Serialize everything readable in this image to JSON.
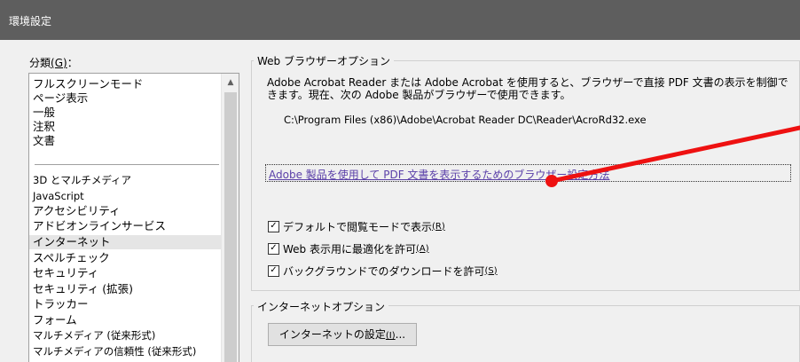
{
  "window": {
    "title": "環境設定"
  },
  "categories": {
    "label": "分類",
    "accel": "(G)",
    "colon": "：",
    "group1": [
      "フルスクリーンモード",
      "ページ表示",
      "一般",
      "注釈",
      "文書"
    ],
    "group2": [
      "3D とマルチメディア",
      "JavaScript",
      "アクセシビリティ",
      "アドビオンラインサービス",
      "インターネット",
      "スペルチェック",
      "セキュリティ",
      "セキュリティ (拡張)",
      "トラッカー",
      "フォーム",
      "マルチメディア (従来形式)",
      "マルチメディアの信頼性 (従来形式)"
    ],
    "selected": "インターネット"
  },
  "web_browser_options": {
    "title": "Web ブラウザーオプション",
    "description": "Adobe Acrobat Reader または Adobe Acrobat を使用すると、ブラウザーで直接 PDF 文書の表示を制御できます。現在、次の Adobe 製品がブラウザーで使用できます。",
    "path": "C:\\Program Files (x86)\\Adobe\\Acrobat Reader DC\\Reader\\AcroRd32.exe",
    "link": "Adobe 製品を使用して PDF 文書を表示するためのブラウザー設定方法",
    "checkboxes": [
      {
        "label": "デフォルトで閲覧モードで表示",
        "accel": "(R)",
        "checked": true
      },
      {
        "label": "Web 表示用に最適化を許可",
        "accel": "(A)",
        "checked": true
      },
      {
        "label": "バックグラウンドでのダウンロードを許可",
        "accel": "(S)",
        "checked": true
      }
    ]
  },
  "internet_options": {
    "title": "インターネットオプション",
    "button_label": "インターネットの設定",
    "button_accel": "(I)",
    "button_ellipsis": "..."
  },
  "annotation": {
    "color": "#ee1111"
  }
}
